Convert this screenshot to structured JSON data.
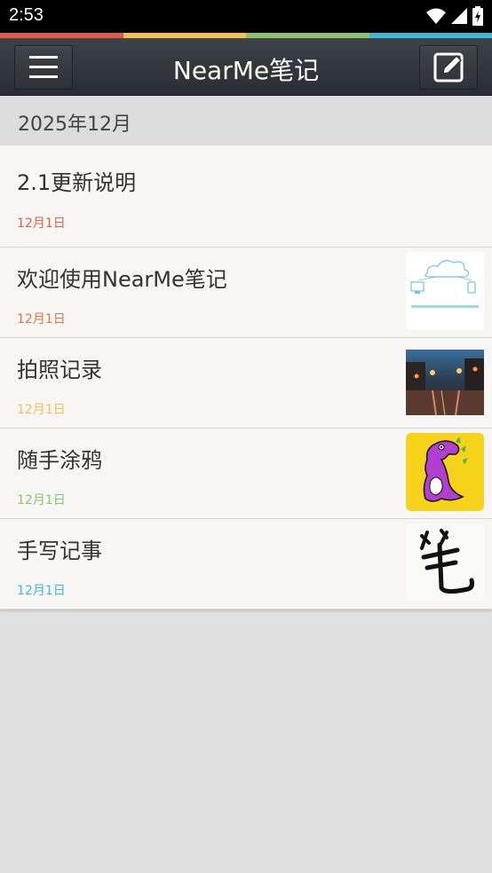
{
  "status_bar": {
    "time": "2:53"
  },
  "app_bar": {
    "title": "NearMe笔记",
    "menu_icon": "menu-icon",
    "edit_icon": "edit-icon"
  },
  "stripe_colors": [
    "#e05a4a",
    "#f2c14e",
    "#8dc26f",
    "#3db8d9"
  ],
  "month_header": "2025年12月",
  "notes": [
    {
      "title": "2.1更新说明",
      "date": "12月1日",
      "date_color": "#e0604a",
      "thumb": ""
    },
    {
      "title": "欢迎使用NearMe笔记",
      "date": "12月1日",
      "date_color": "#e0744a",
      "thumb": "cloud-sync-image"
    },
    {
      "title": "拍照记录",
      "date": "12月1日",
      "date_color": "#f2c14e",
      "thumb": "street-photo-image"
    },
    {
      "title": "随手涂鸦",
      "date": "12月1日",
      "date_color": "#8dc26f",
      "thumb": "dinosaur-doodle-image"
    },
    {
      "title": "手写记事",
      "date": "12月1日",
      "date_color": "#3db8d9",
      "thumb": "handwriting-image"
    }
  ]
}
